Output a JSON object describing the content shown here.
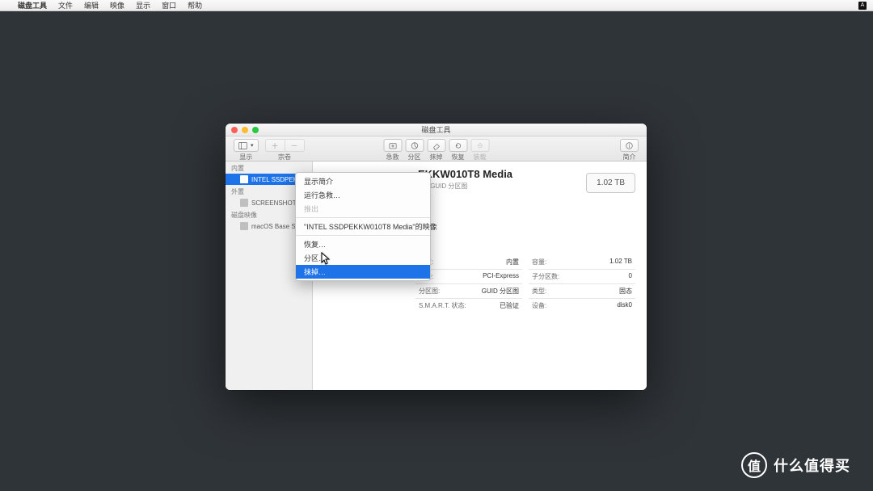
{
  "menubar": {
    "app": "磁盘工具",
    "items": [
      "文件",
      "编辑",
      "映像",
      "显示",
      "窗口",
      "帮助"
    ]
  },
  "window": {
    "title": "磁盘工具",
    "toolbar": {
      "view": {
        "label": "显示"
      },
      "volume": {
        "label": "宗卷",
        "plus": "＋",
        "minus": "－"
      },
      "center": [
        {
          "label": "急救"
        },
        {
          "label": "分区"
        },
        {
          "label": "抹掉"
        },
        {
          "label": "恢复"
        },
        {
          "label": "装载"
        }
      ],
      "info": {
        "label": "简介"
      }
    },
    "sidebar": {
      "sections": [
        {
          "head": "内置",
          "items": [
            {
              "label": "INTEL SSDPEKKW…",
              "sel": true
            }
          ]
        },
        {
          "head": "外置",
          "items": [
            {
              "label": "SCREENSHOT",
              "sel": false
            }
          ]
        },
        {
          "head": "磁盘映像",
          "items": [
            {
              "label": "macOS Base Sys…",
              "sel": false
            }
          ]
        }
      ]
    },
    "disk": {
      "title_suffix": "EKKW010T8 Media",
      "subtitle": "盘 · GUID 分区图",
      "size": "1.02 TB"
    },
    "info": {
      "left": [
        {
          "k": "位置:",
          "v": "内置"
        },
        {
          "k": "连接:",
          "v": "PCI-Express"
        },
        {
          "k": "分区图:",
          "v": "GUID 分区图"
        },
        {
          "k": "S.M.A.R.T. 状态:",
          "v": "已验证"
        }
      ],
      "right": [
        {
          "k": "容量:",
          "v": "1.02 TB"
        },
        {
          "k": "子分区数:",
          "v": "0"
        },
        {
          "k": "类型:",
          "v": "固态"
        },
        {
          "k": "设备:",
          "v": "disk0"
        }
      ]
    }
  },
  "context_menu": {
    "items": [
      {
        "label": "显示简介",
        "state": "normal"
      },
      {
        "label": "运行急救…",
        "state": "normal"
      },
      {
        "label": "推出",
        "state": "disabled"
      },
      {
        "sep": true
      },
      {
        "label": "\"INTEL SSDPEKKW010T8 Media\"的映像",
        "state": "normal"
      },
      {
        "sep": true
      },
      {
        "label": "恢复…",
        "state": "normal"
      },
      {
        "label": "分区…",
        "state": "normal"
      },
      {
        "label": "抹掉…",
        "state": "selected"
      }
    ]
  },
  "watermark": {
    "badge": "值",
    "text": "什么值得买"
  }
}
